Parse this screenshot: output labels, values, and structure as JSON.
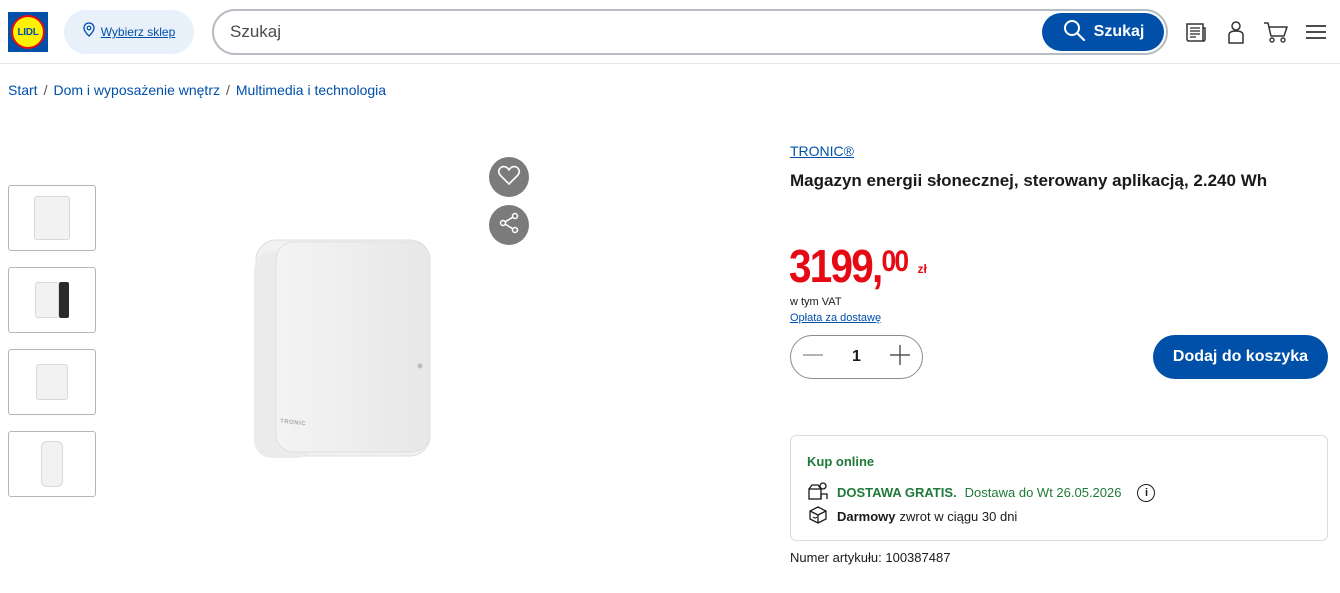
{
  "header": {
    "logo_text": "LIDL",
    "store_label": "Wybierz sklep",
    "search_placeholder": "Szukaj",
    "search_button": "Szukaj",
    "icons": [
      "leaflet-icon",
      "account-icon",
      "cart-icon",
      "menu-icon"
    ]
  },
  "breadcrumb": {
    "items": [
      "Start",
      "Dom i wyposażenie wnętrz",
      "Multimedia i technologia"
    ],
    "separator": "/"
  },
  "product": {
    "brand": "TRONIC®",
    "title": "Magazyn energii słonecznej, sterowany aplikacją, 2.240 Wh",
    "price_main": "3199,",
    "price_cents": "00",
    "currency": "zł",
    "vat_text": "w tym VAT",
    "shipping_link": "Opłata za dostawę",
    "quantity": "1",
    "add_to_cart": "Dodaj do koszyka",
    "image_brand_mark": "TRONIC"
  },
  "delivery": {
    "title": "Kup online",
    "free_delivery": "DOSTAWA GRATIS.",
    "delivery_date": "Dostawa do Wt 26.05.2026",
    "return_bold": "Darmowy",
    "return_text": "zwrot w ciągu 30 dni"
  },
  "article_number": "Numer artykułu: 100387487",
  "colors": {
    "brand_blue": "#0050aa",
    "price_red": "#e60a14",
    "delivery_green": "#1f7a3a"
  }
}
